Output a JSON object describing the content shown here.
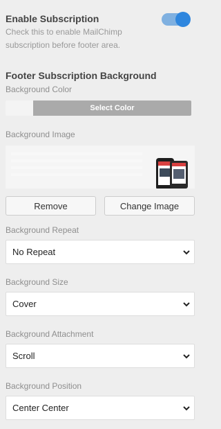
{
  "subscription": {
    "title": "Enable Subscription",
    "description": "Check this to enable MailChimp subscription before footer area.",
    "enabled": true
  },
  "footer_bg": {
    "title": "Footer Subscription Background",
    "color_label": "Background Color",
    "select_color_label": "Select Color",
    "image_label": "Background Image",
    "remove_label": "Remove",
    "change_image_label": "Change Image"
  },
  "fields": [
    {
      "label": "Background Repeat",
      "value": "No Repeat"
    },
    {
      "label": "Background Size",
      "value": "Cover"
    },
    {
      "label": "Background Attachment",
      "value": "Scroll"
    },
    {
      "label": "Background Position",
      "value": "Center Center"
    }
  ],
  "icons": {
    "dropdown": "chevron-down-icon"
  },
  "colors": {
    "toggle_on": "#2e86de",
    "select_color_bar": "#aaaaaa"
  }
}
